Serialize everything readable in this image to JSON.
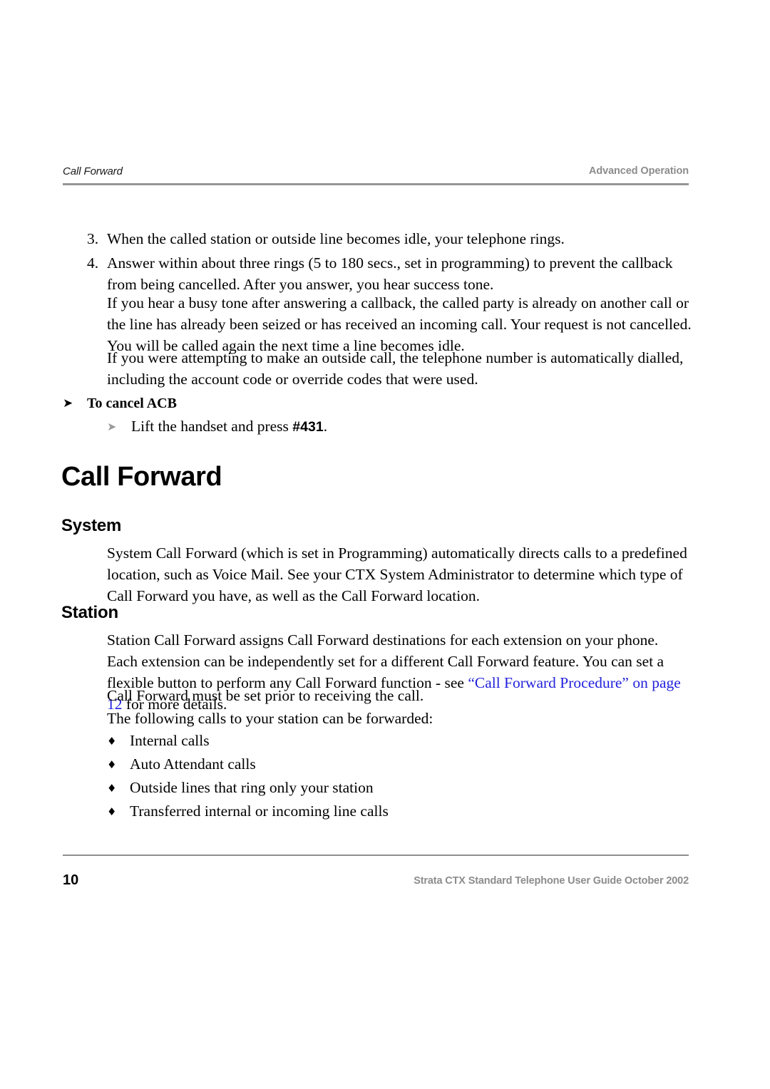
{
  "header": {
    "left_title": "Call Forward",
    "right_title": "Advanced Operation"
  },
  "footer": {
    "page_number": "10",
    "guide_line": "Strata CTX Standard Telephone User Guide  October 2002"
  },
  "colors": {
    "link": "#2222dd",
    "rule": "#909090",
    "header_right_text": "#8c8c8c",
    "sub_arrow": "#9a9a9a"
  },
  "icons": {
    "arrow_black": "➤",
    "arrow_gray": "➤",
    "diamond_bullet": "♦"
  },
  "body": {
    "step_3": {
      "number": "3.",
      "text": "When the called station or outside line becomes idle, your telephone rings."
    },
    "step_4": {
      "number": "4.",
      "text": "Answer within about three rings (5 to 180 secs., set in programming) to prevent the callback from being cancelled. After you answer, you hear success tone."
    },
    "para_busy_tone": "If you hear a busy tone after answering a callback, the called party is already on another call or the line has already been seized or has received an incoming call. Your request is not cancelled. You will be called again the next time a line becomes idle.",
    "para_outside_call": "If you were attempting to make an outside call, the telephone number is automatically dialled, including the account code or override codes that were used.",
    "cancel_acb_heading": "To cancel ACB",
    "cancel_acb_step_prefix": "Lift the handset and press ",
    "cancel_acb_code": "#431",
    "cancel_acb_step_suffix": "."
  },
  "call_forward": {
    "title": "Call Forward",
    "system": {
      "heading": "System",
      "paragraph": "System Call Forward (which is set in Programming) automatically directs calls to a predefined location, such as Voice Mail. See your CTX System Administrator to determine which type of Call Forward you have, as well as the Call Forward location."
    },
    "station": {
      "heading": "Station",
      "paragraph_prefix": "Station Call Forward assigns Call Forward destinations for each extension on your phone. Each extension can be independently set for a different Call Forward feature. You can set a flexible button to perform any Call Forward function - see ",
      "link_text": "“Call Forward Procedure” on page 12",
      "paragraph_suffix": " for more details.",
      "paragraph_2": "Call Forward must be set prior to receiving the call.",
      "paragraph_3": "The following calls to your station can be forwarded:",
      "bullets": [
        "Internal calls",
        "Auto Attendant calls",
        "Outside lines that ring only your station",
        "Transferred internal or incoming line calls"
      ]
    }
  }
}
